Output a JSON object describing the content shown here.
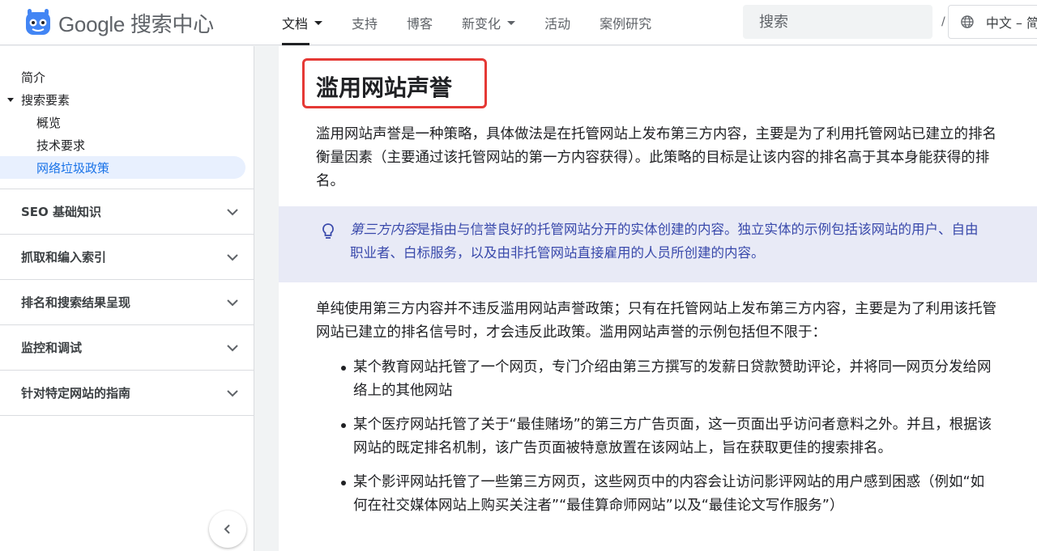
{
  "header": {
    "logo_text": "Google 搜索中心",
    "nav": [
      {
        "label": "文档",
        "dropdown": true,
        "active": true
      },
      {
        "label": "支持",
        "dropdown": false
      },
      {
        "label": "博客",
        "dropdown": false
      },
      {
        "label": "新变化",
        "dropdown": true
      },
      {
        "label": "活动",
        "dropdown": false
      },
      {
        "label": "案例研究",
        "dropdown": false
      }
    ],
    "search_placeholder": "搜索",
    "search_shortcut": "/",
    "language": "中文 – 简体"
  },
  "sidebar": {
    "items": [
      {
        "label": "简介"
      },
      {
        "label": "搜索要素"
      },
      {
        "label": "概览"
      },
      {
        "label": "技术要求"
      },
      {
        "label": "网络垃圾政策"
      }
    ],
    "sections": [
      {
        "label": "SEO 基础知识"
      },
      {
        "label": "抓取和编入索引"
      },
      {
        "label": "排名和搜索结果呈现"
      },
      {
        "label": "监控和调试"
      },
      {
        "label": "针对特定网站的指南"
      }
    ]
  },
  "content": {
    "title": "滥用网站声誉",
    "intro": "滥用网站声誉是一种策略，具体做法是在托管网站上发布第三方内容，主要是为了利用托管网站已建立的排名衡量因素（主要通过该托管网站的第一方内容获得）。此策略的目标是让该内容的排名高于其本身能获得的排名。",
    "note_term": "第三方内容",
    "note_rest": "是指由与信誉良好的托管网站分开的实体创建的内容。独立实体的示例包括该网站的用户、自由职业者、白标服务，以及由非托管网站直接雇用的人员所创建的内容。",
    "para2": "单纯使用第三方内容并不违反滥用网站声誉政策；只有在托管网站上发布第三方内容，主要是为了利用该托管网站已建立的排名信号时，才会违反此政策。滥用网站声誉的示例包括但不限于：",
    "bullets": [
      "某个教育网站托管了一个网页，专门介绍由第三方撰写的发薪日贷款赞助评论，并将同一网页分发给网络上的其他网站",
      "某个医疗网站托管了关于“最佳赌场”的第三方广告页面，这一页面出乎访问者意料之外。并且，根据该网站的既定排名机制，该广告页面被特意放置在该网站上，旨在获取更佳的搜索排名。",
      "某个影评网站托管了一些第三方网页，这些网页中的内容会让访问影评网站的用户感到困惑（例如“如何在社交媒体网站上购买关注者”“最佳算命师网站”以及“最佳论文写作服务”）"
    ]
  },
  "colors": {
    "accent": "#1a73e8",
    "highlight_border": "#e53935",
    "note_bg": "#e8eaf6",
    "note_text": "#3949ab"
  }
}
